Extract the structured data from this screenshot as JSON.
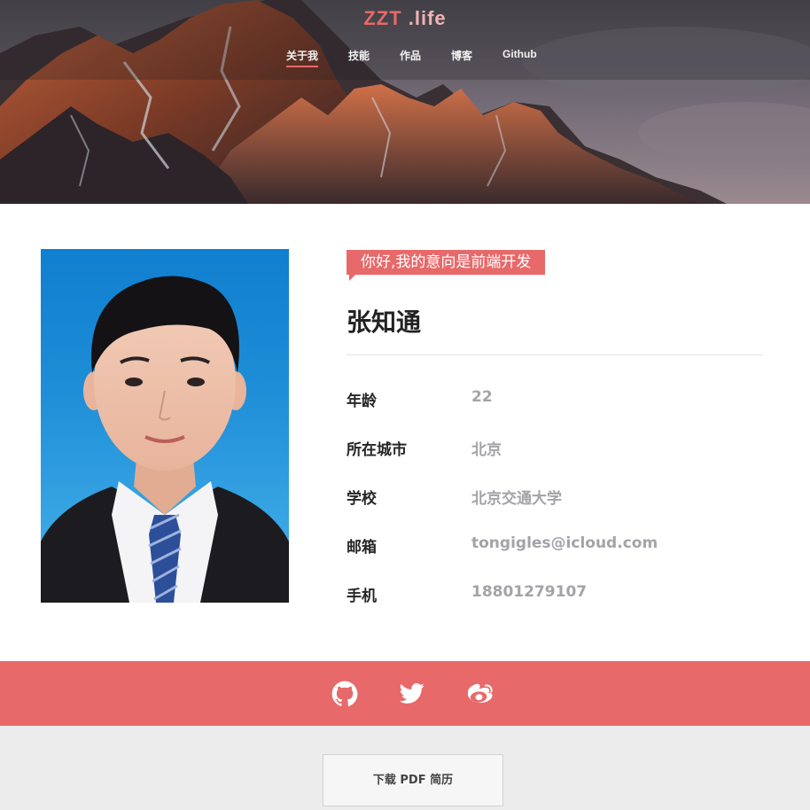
{
  "header": {
    "logo_brand": "ZZT",
    "logo_suffix": ".life",
    "nav": [
      {
        "label": "关于我",
        "active": true
      },
      {
        "label": "技能",
        "active": false
      },
      {
        "label": "作品",
        "active": false
      },
      {
        "label": "博客",
        "active": false
      },
      {
        "label": "Github",
        "active": false
      }
    ]
  },
  "profile": {
    "tagline": "你好,我的意向是前端开发",
    "name": "张知通",
    "info": [
      {
        "label": "年龄",
        "value": "22"
      },
      {
        "label": "所在城市",
        "value": "北京"
      },
      {
        "label": "学校",
        "value": "北京交通大学"
      },
      {
        "label": "邮箱",
        "value": "tongigles@icloud.com"
      },
      {
        "label": "手机",
        "value": "18801279107"
      }
    ]
  },
  "social": {
    "icons": [
      "github-icon",
      "twitter-icon",
      "weibo-icon"
    ]
  },
  "download": {
    "label": "下载 PDF 简历"
  },
  "colors": {
    "accent": "#e8696a",
    "value_gray": "#a3a3a8",
    "footer_bg": "#ececec"
  }
}
